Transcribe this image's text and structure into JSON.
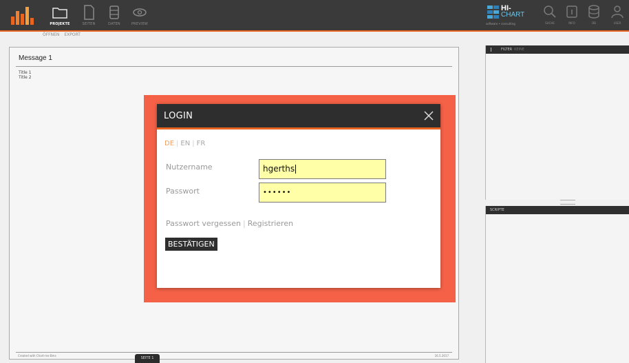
{
  "toolbar": {
    "items": [
      {
        "label": "PROJEKTE",
        "icon": "folder-icon"
      },
      {
        "label": "SEITEN",
        "icon": "document-icon"
      },
      {
        "label": "DATEN",
        "icon": "database-icon"
      },
      {
        "label": "PREVIEW",
        "icon": "eye-icon"
      }
    ],
    "brand": {
      "line1": "HI-",
      "line2": "CHART",
      "tagline": "software • consulting"
    },
    "right_items": [
      {
        "label": "SUCHE",
        "icon": "search-icon"
      },
      {
        "label": "INFO",
        "icon": "info-icon"
      },
      {
        "label": "DB",
        "icon": "database-icon"
      },
      {
        "label": "USER",
        "icon": "user-icon"
      }
    ],
    "accent": "#e8641f"
  },
  "subtabs": [
    "ÖFFNEN",
    "EXPORT"
  ],
  "message": {
    "title": "Message 1",
    "lines": [
      "Title 1",
      "Title 2"
    ],
    "footer_left": "Created with Chart-me Bms",
    "footer_right": "16.5.2017",
    "page_tab": "SEITE 1"
  },
  "filter": {
    "label": "FILTER",
    "sub": "KEINE"
  },
  "scripts": {
    "label": "SCRIPTE"
  },
  "login": {
    "title": "LOGIN",
    "languages": [
      "DE",
      "EN",
      "FR"
    ],
    "active_language": "DE",
    "username_label": "Nutzername",
    "username_value": "hgerths",
    "password_label": "Passwort",
    "password_value": "••••••",
    "forgot_link": "Passwort vergessen",
    "register_link": "Registrieren",
    "submit_label": "BESTÄTIGEN",
    "highlight_color": "#f46147"
  }
}
